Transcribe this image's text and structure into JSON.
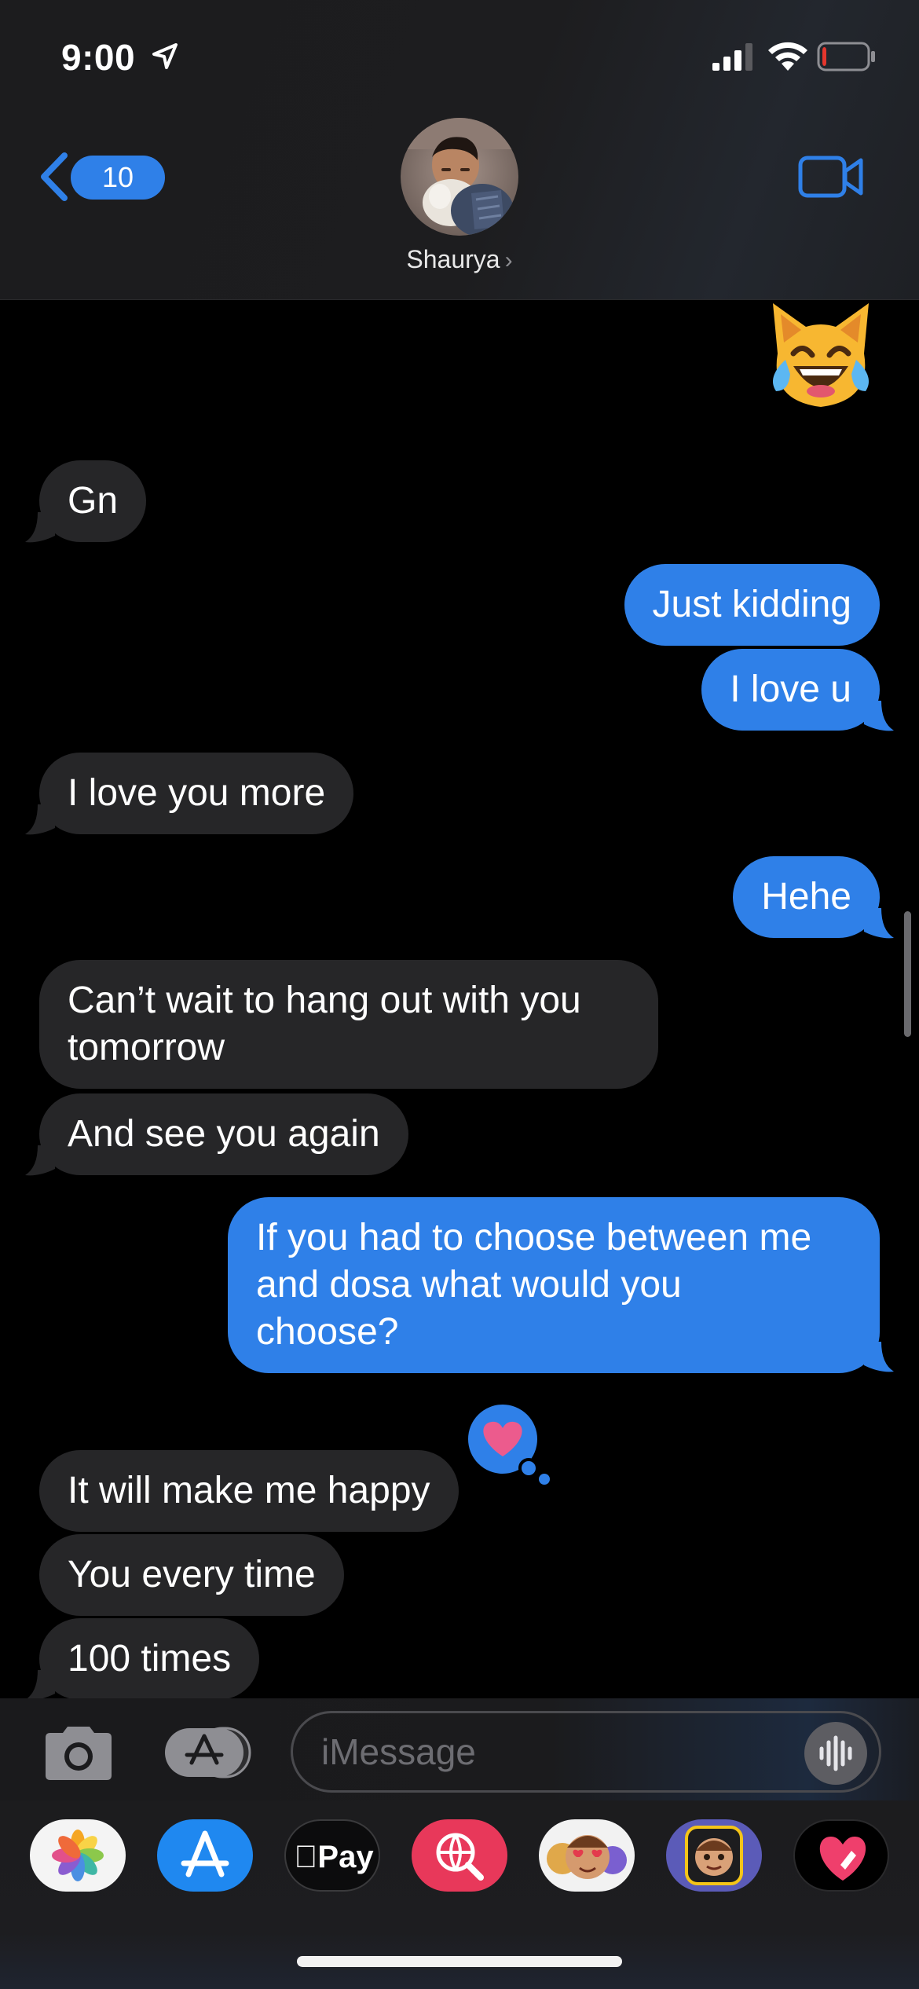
{
  "status_bar": {
    "time": "9:00",
    "battery_level": 0.1,
    "battery_color": "#e5362d"
  },
  "nav": {
    "back_count": "10",
    "contact_name": "Shaurya",
    "chevron": "›",
    "accent_color": "#2f80e8"
  },
  "messages": [
    {
      "from": "them",
      "type": "emoji",
      "emoji_name": "cat-face-with-tears-of-joy"
    },
    {
      "from": "them",
      "text": "Gn"
    },
    {
      "from": "me",
      "text": "Just kidding"
    },
    {
      "from": "me",
      "text": "I love u"
    },
    {
      "from": "them",
      "text": "I love you more"
    },
    {
      "from": "me",
      "text": "Hehe"
    },
    {
      "from": "them",
      "text": "Can’t wait to hang out with you\ntomorrow"
    },
    {
      "from": "them",
      "text": "And see you again"
    },
    {
      "from": "me",
      "text": "If you had to choose between me\nand dosa what would you\nchoose?",
      "tapback": "heart"
    },
    {
      "from": "them",
      "text": "It will make me happy"
    },
    {
      "from": "them",
      "text": "You every time"
    },
    {
      "from": "them",
      "text": "100 times"
    }
  ],
  "input": {
    "placeholder": "iMessage"
  },
  "app_drawer": {
    "apps": [
      "photos-app",
      "app-store-app",
      "apple-pay-app",
      "image-search-app",
      "animoji-app",
      "memoji-app",
      "digital-touch-app"
    ],
    "apple_pay_label": "Pay"
  }
}
